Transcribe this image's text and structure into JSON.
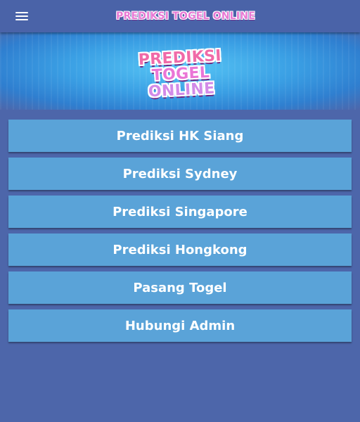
{
  "header": {
    "logo_text": "PREDIKSI TOGEL ONLINE",
    "menu_icon": "hamburger-menu-icon"
  },
  "banner": {
    "logo_lines": [
      "PREDIKSI",
      "TOGEL",
      "ONLINE"
    ]
  },
  "menu": {
    "items": [
      {
        "label": "Prediksi HK Siang"
      },
      {
        "label": "Prediksi Sydney"
      },
      {
        "label": "Prediksi Singapore"
      },
      {
        "label": "Prediksi Hongkong"
      },
      {
        "label": "Pasang Togel"
      },
      {
        "label": "Hubungi Admin"
      }
    ]
  },
  "colors": {
    "background": "#4d66aa",
    "button": "#5aa3d8",
    "logo_pink": "#f06aa8"
  }
}
